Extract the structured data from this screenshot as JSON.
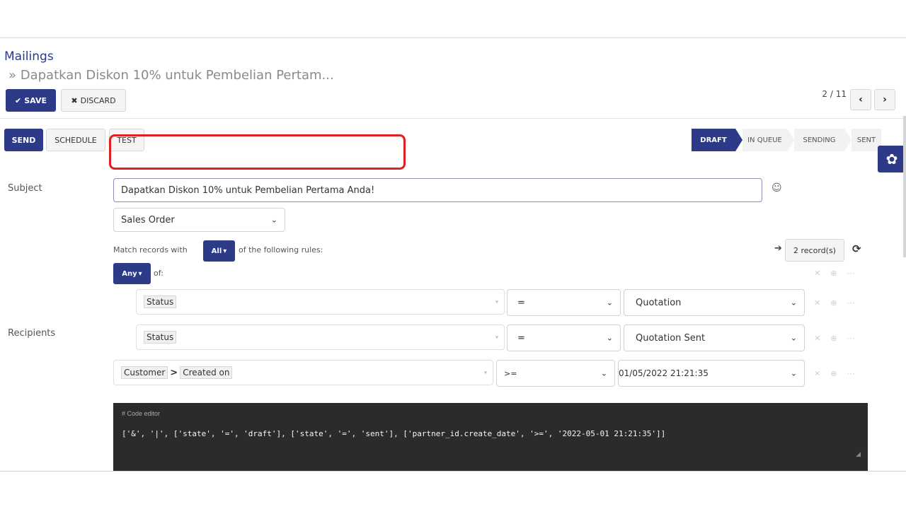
{
  "breadcrumb": {
    "root": "Mailings",
    "current": "» Dapatkan Diskon 10% untuk Pembelian Pertam..."
  },
  "toolbar": {
    "save_label": "SAVE",
    "discard_label": "DISCARD",
    "pager": "2 / 11",
    "prev_icon": "‹",
    "next_icon": "›"
  },
  "actions": {
    "send": "SEND",
    "schedule": "SCHEDULE",
    "test": "TEST"
  },
  "statusbar": {
    "stages": [
      "DRAFT",
      "IN QUEUE",
      "SENDING",
      "SENT"
    ],
    "active": "DRAFT"
  },
  "form": {
    "subject_label": "Subject",
    "subject_value": "Dapatkan Diskon 10% untuk Pembelian Pertama Anda!",
    "recipients_label": "Recipients",
    "model_value": "Sales Order"
  },
  "domain": {
    "match_prefix": "Match records with",
    "match_all": "All",
    "match_suffix": "of the following rules:",
    "record_count": "2 record(s)",
    "any_label": "Any",
    "of_label": "of:",
    "rules": [
      {
        "field": "Status",
        "operator": "=",
        "value": "Quotation"
      },
      {
        "field": "Status",
        "operator": "=",
        "value": "Quotation Sent"
      }
    ],
    "rule3": {
      "field_part1": "Customer",
      "separator": ">",
      "field_part2": "Created on",
      "operator": ">=",
      "value": "01/05/2022 21:21:35"
    }
  },
  "code_editor": {
    "comment": "# Code editor",
    "code": "['&', '|', ['state', '=', 'draft'], ['state', '=', 'sent'], ['partner_id.create_date', '>=', '2022-05-01 21:21:35']]"
  },
  "colors": {
    "primary": "#2c3a87",
    "highlight": "#e02020",
    "code_bg": "#2b2b2b"
  }
}
